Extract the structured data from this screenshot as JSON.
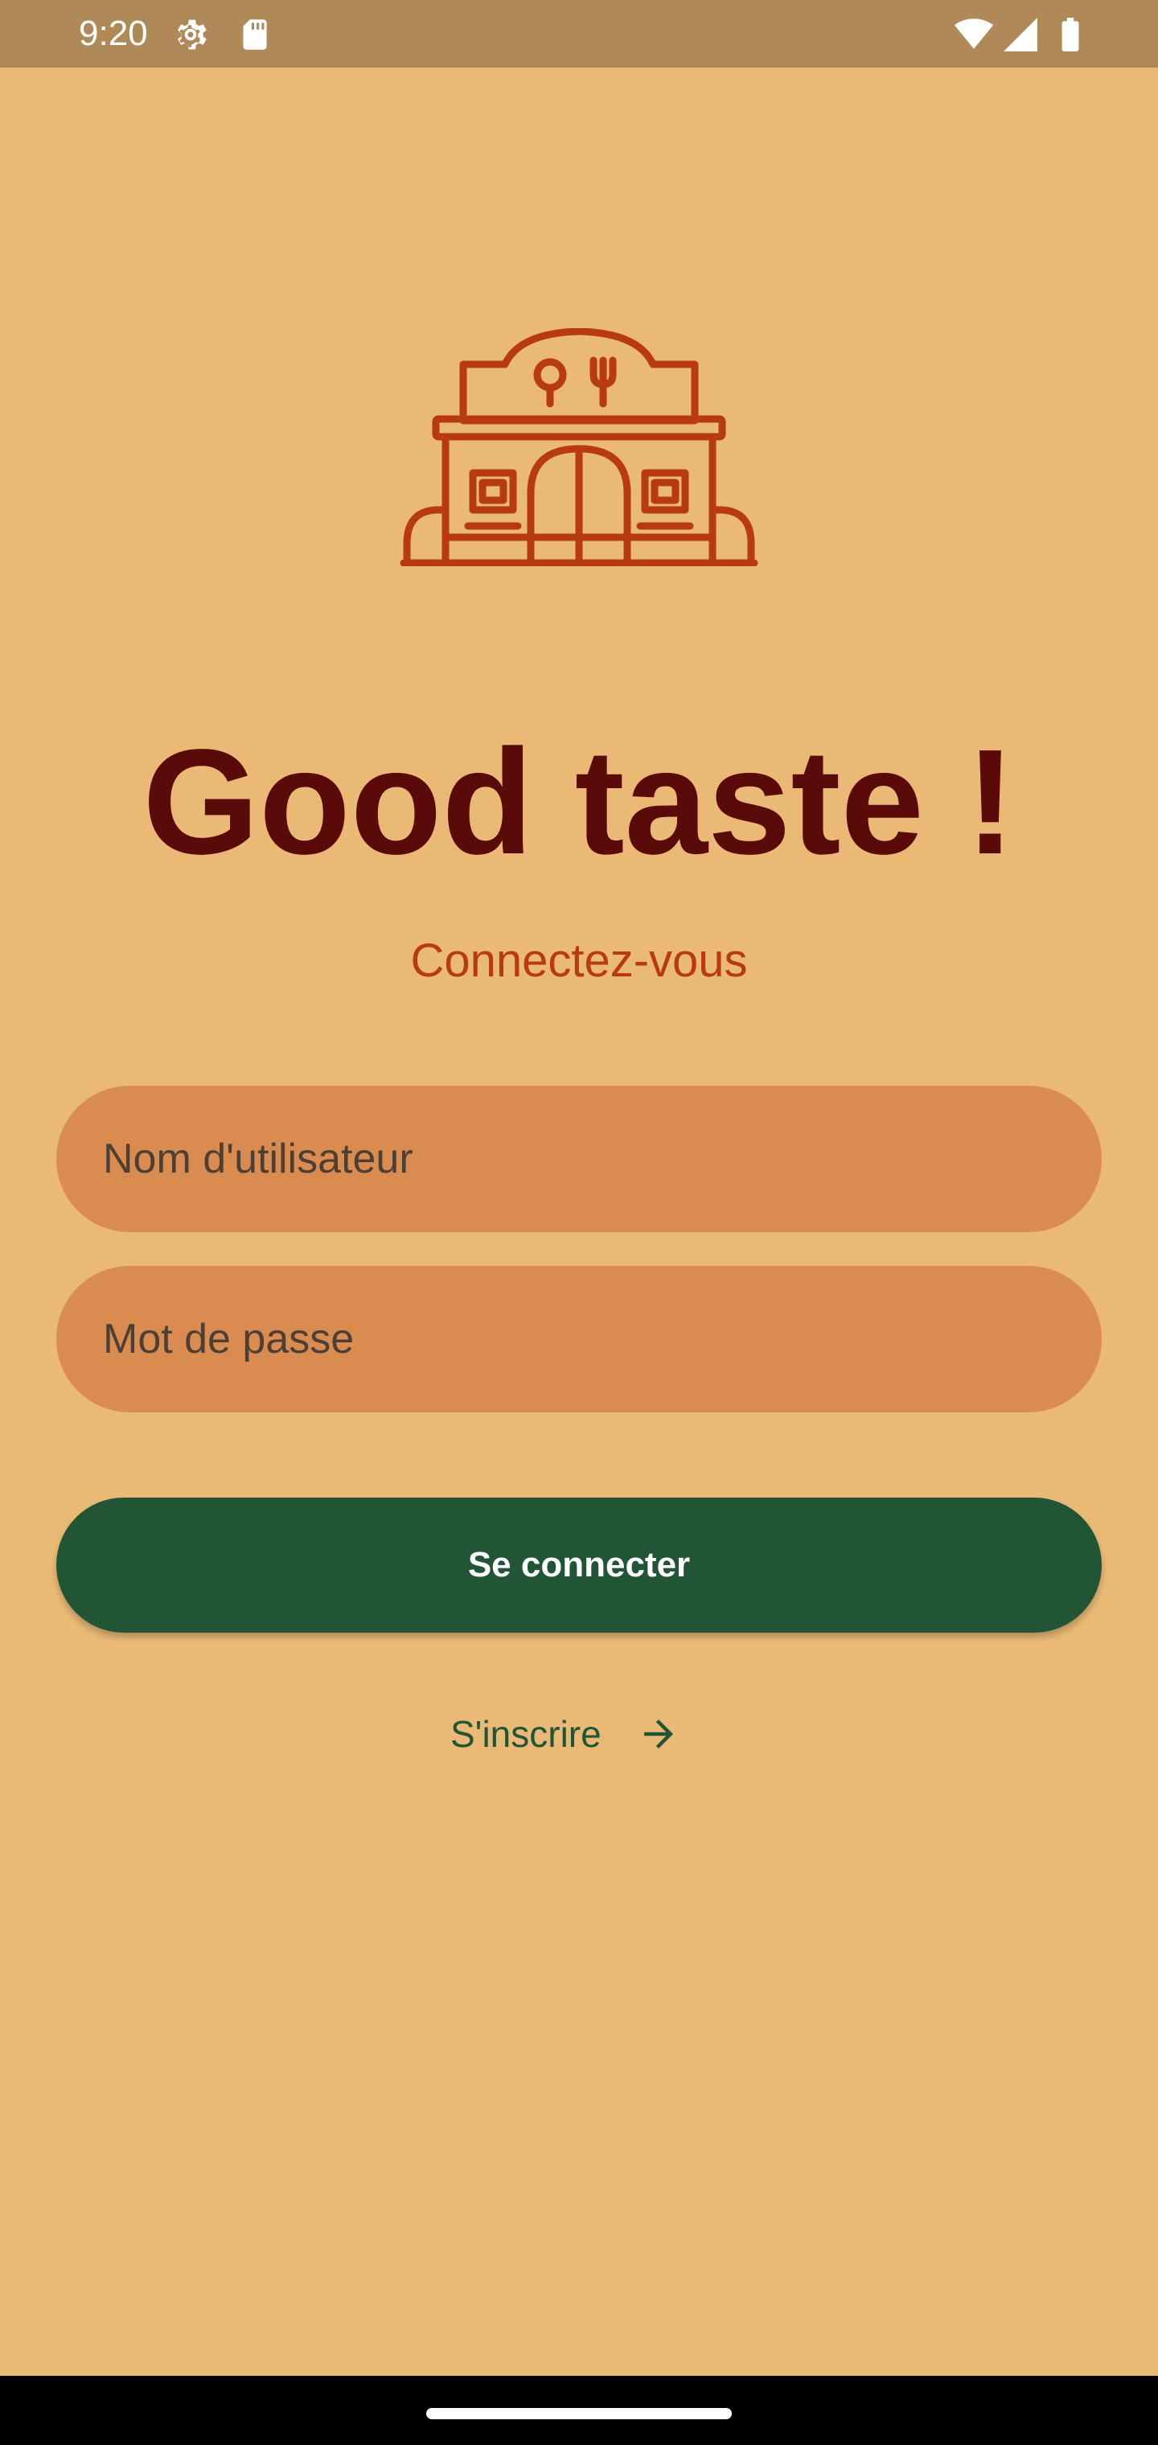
{
  "status_bar": {
    "time": "9:20",
    "icons": [
      "settings-gear-icon",
      "sd-card-icon",
      "wifi-icon",
      "signal-icon",
      "battery-icon"
    ]
  },
  "logo": {
    "icon": "restaurant-building-icon",
    "color": "#B83A10"
  },
  "title": "Good taste !",
  "subtitle": "Connectez-vous",
  "form": {
    "username_placeholder": "Nom d'utilisateur",
    "password_placeholder": "Mot de passe",
    "login_label": "Se connecter",
    "signup_label": "S'inscrire",
    "signup_icon": "arrow-right-icon"
  },
  "colors": {
    "background": "#E9B975",
    "status_bar": "#AF8A58",
    "title": "#5A0A08",
    "subtitle": "#B83A10",
    "field": "#DA8C50",
    "primary_button": "#225536"
  }
}
